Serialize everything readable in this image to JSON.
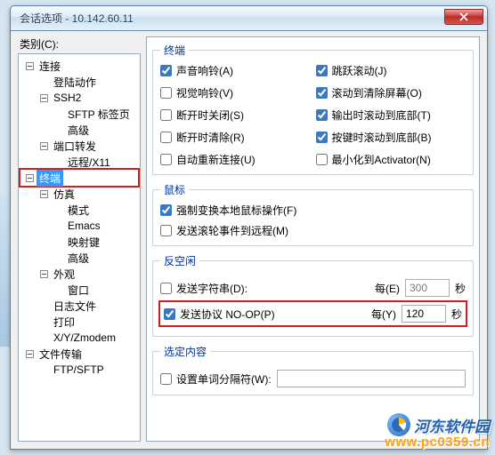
{
  "window": {
    "title": "会话选项 - 10.142.60.11"
  },
  "labels": {
    "category": "类别(C):"
  },
  "tree": [
    {
      "d": 0,
      "tw": "minus",
      "label": "连接"
    },
    {
      "d": 1,
      "tw": "none",
      "label": "登陆动作"
    },
    {
      "d": 1,
      "tw": "minus",
      "label": "SSH2"
    },
    {
      "d": 2,
      "tw": "none",
      "label": "SFTP 标签页"
    },
    {
      "d": 2,
      "tw": "none",
      "label": "高级"
    },
    {
      "d": 1,
      "tw": "minus",
      "label": "端口转发"
    },
    {
      "d": 2,
      "tw": "none",
      "label": "远程/X11"
    },
    {
      "d": 0,
      "tw": "minus",
      "label": "终端",
      "sel": true,
      "red": true
    },
    {
      "d": 1,
      "tw": "minus",
      "label": "仿真"
    },
    {
      "d": 2,
      "tw": "none",
      "label": "模式"
    },
    {
      "d": 2,
      "tw": "none",
      "label": "Emacs"
    },
    {
      "d": 2,
      "tw": "none",
      "label": "映射键"
    },
    {
      "d": 2,
      "tw": "none",
      "label": "高级"
    },
    {
      "d": 1,
      "tw": "minus",
      "label": "外观"
    },
    {
      "d": 2,
      "tw": "none",
      "label": "窗口"
    },
    {
      "d": 1,
      "tw": "none",
      "label": "日志文件"
    },
    {
      "d": 1,
      "tw": "none",
      "label": "打印"
    },
    {
      "d": 1,
      "tw": "none",
      "label": "X/Y/Zmodem"
    },
    {
      "d": 0,
      "tw": "minus",
      "label": "文件传输"
    },
    {
      "d": 1,
      "tw": "none",
      "label": "FTP/SFTP"
    }
  ],
  "terminal": {
    "legend": "终端",
    "opts": [
      {
        "label": "声音响铃(A)",
        "checked": true
      },
      {
        "label": "跳跃滚动(J)",
        "checked": true
      },
      {
        "label": "视觉响铃(V)",
        "checked": false
      },
      {
        "label": "滚动到清除屏幕(O)",
        "checked": true
      },
      {
        "label": "断开时关闭(S)",
        "checked": false
      },
      {
        "label": "输出时滚动到底部(T)",
        "checked": true
      },
      {
        "label": "断开时清除(R)",
        "checked": false
      },
      {
        "label": "按键时滚动到底部(B)",
        "checked": true
      },
      {
        "label": "自动重新连接(U)",
        "checked": false
      },
      {
        "label": "最小化到Activator(N)",
        "checked": false
      }
    ]
  },
  "mouse": {
    "legend": "鼠标",
    "force": {
      "label": "强制变换本地鼠标操作(F)",
      "checked": true
    },
    "wheel": {
      "label": "发送滚轮事件到远程(M)",
      "checked": false
    }
  },
  "antiidle": {
    "legend": "反空闲",
    "sendstr": {
      "label": "发送字符串(D):",
      "checked": false
    },
    "every_e": "每(E)",
    "val_e": "300",
    "sec": "秒",
    "noop": {
      "label": "发送协议 NO-OP(P)",
      "checked": true
    },
    "every_y": "每(Y)",
    "val_y": "120"
  },
  "selection": {
    "legend": "选定内容",
    "worddelim": {
      "label": "设置单词分隔符(W):",
      "checked": false,
      "value": ""
    }
  },
  "watermark": {
    "brand": "河东软件园",
    "url": "www.pc0359.cn"
  }
}
